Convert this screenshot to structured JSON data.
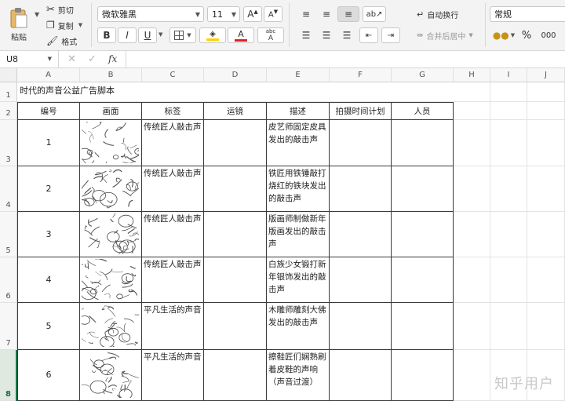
{
  "ribbon": {
    "clipboard": {
      "paste": "粘贴",
      "cut": "剪切",
      "copy": "复制",
      "format_painter": "格式"
    },
    "font": {
      "name": "微软雅黑",
      "size": "11",
      "bold": "B",
      "italic": "I",
      "underline": "U",
      "phonetic": "abc",
      "phonetic_sub": "A"
    },
    "alignment": {
      "wrap_text": "自动换行",
      "merge_center": "合并后居中"
    },
    "number": {
      "format": "常规",
      "percent": "%",
      "comma": "000"
    },
    "colors": {
      "highlight": "#ffd200",
      "font_red": "#e02020"
    }
  },
  "formula_bar": {
    "name_box": "U8",
    "fx": "fx",
    "value": ""
  },
  "columns": [
    "A",
    "B",
    "C",
    "D",
    "E",
    "F",
    "G",
    "H",
    "I",
    "J"
  ],
  "rows": [
    "1",
    "2",
    "3",
    "4",
    "5",
    "6",
    "7",
    "8"
  ],
  "sheet": {
    "title": "时代的声音公益广告脚本",
    "headers": [
      "编号",
      "画面",
      "标签",
      "运镜",
      "描述",
      "拍摄时间计划",
      "人员"
    ],
    "records": [
      {
        "num": "1",
        "tag": "传统匠人敲击声",
        "desc": "皮艺师固定皮具发出的敲击声"
      },
      {
        "num": "2",
        "tag": "传统匠人敲击声",
        "desc": "铁匠用铁锤敲打烧红的铁块发出的敲击声"
      },
      {
        "num": "3",
        "tag": "传统匠人敲击声",
        "desc": "版画师制做新年版画发出的敲击声"
      },
      {
        "num": "4",
        "tag": "传统匠人敲击声",
        "desc": "白族少女锻打新年银饰发出的敲击声"
      },
      {
        "num": "5",
        "tag": "平凡生活的声音",
        "desc": "木雕师雕刻大佛发出的敲击声"
      },
      {
        "num": "6",
        "tag": "平凡生活的声音",
        "desc": "擦鞋匠们娴熟刷着皮鞋的声响（声音过渡）"
      }
    ]
  },
  "watermark": "知乎用户"
}
